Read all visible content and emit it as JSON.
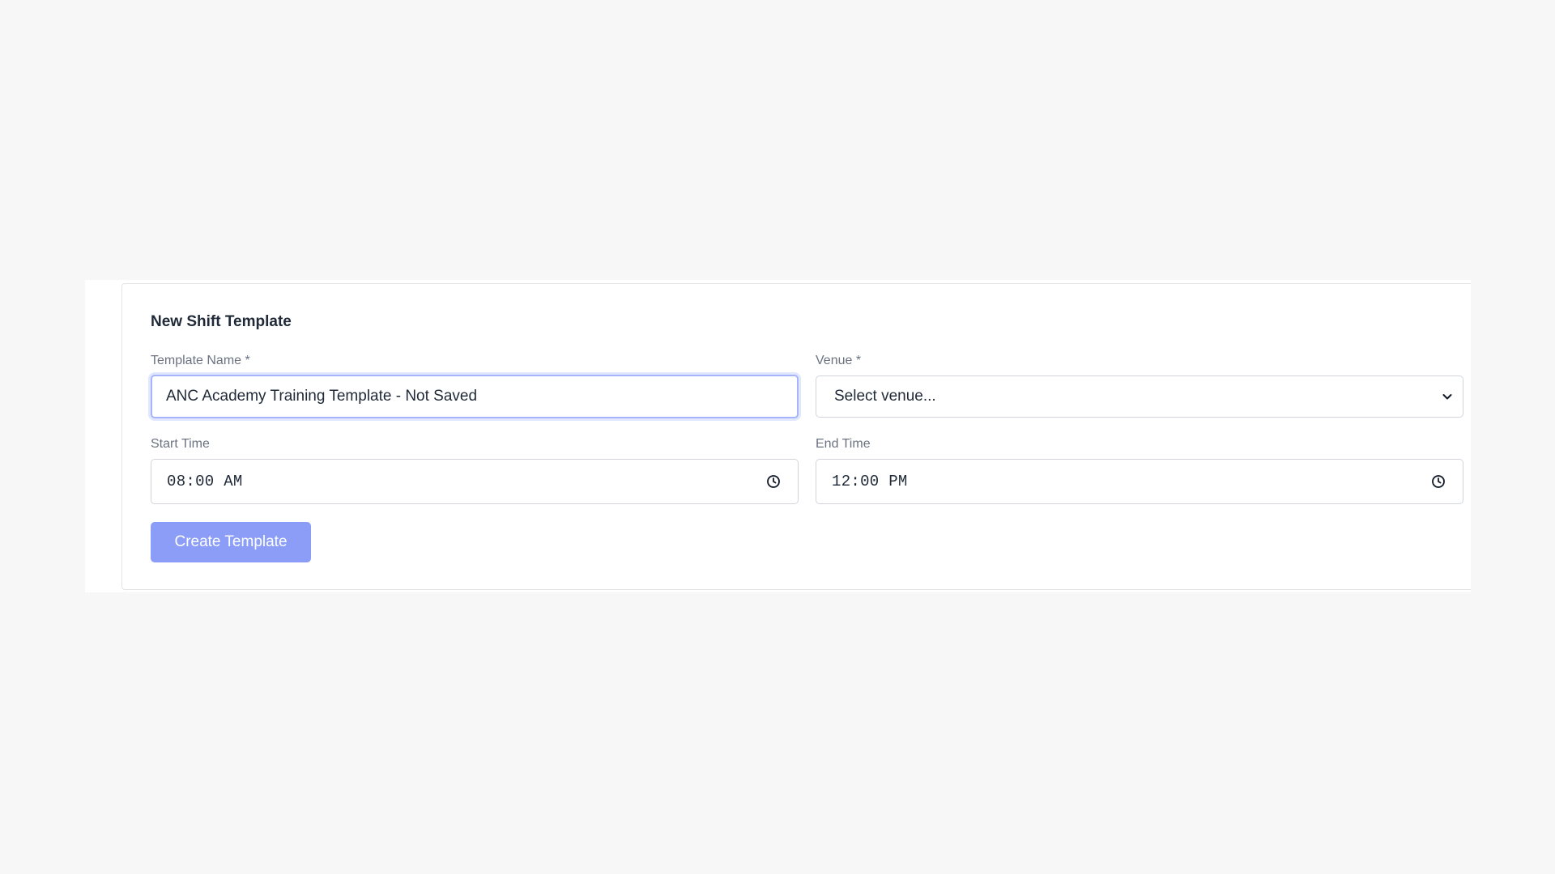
{
  "form": {
    "title": "New Shift Template",
    "template_name": {
      "label": "Template Name *",
      "value": "ANC Academy Training Template - Not Saved"
    },
    "venue": {
      "label": "Venue *",
      "selected": "Select venue..."
    },
    "start_time": {
      "label": "Start Time",
      "value": "08:00 AM"
    },
    "end_time": {
      "label": "End Time",
      "value": "12:00 PM"
    },
    "submit_label": "Create Template"
  },
  "icons": {
    "dropdown": "chevron-down-icon",
    "time": "clock-icon"
  },
  "colors": {
    "page_background": "#f7f7f7",
    "primary_button": "#8b9df7",
    "focus_ring": "#a5b4fc",
    "label_text": "#6b7280"
  }
}
